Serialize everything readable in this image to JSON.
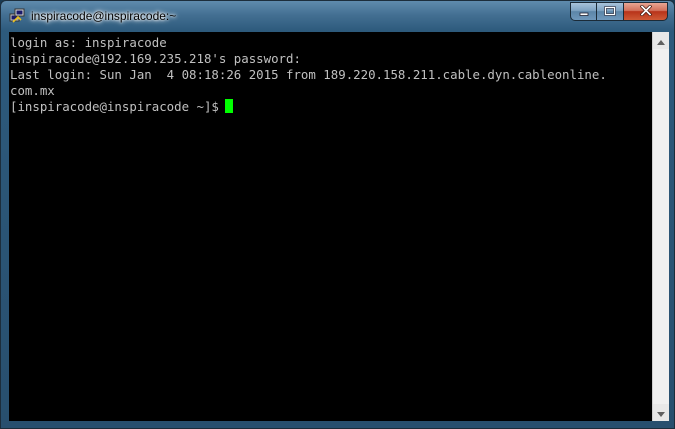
{
  "window": {
    "title": "inspiracode@inspiracode:~",
    "app_icon": "putty-icon",
    "controls": {
      "minimize": "minimize-icon",
      "maximize": "maximize-icon",
      "close": "close-icon"
    }
  },
  "terminal": {
    "lines": [
      "login as: inspiracode",
      "inspiracode@192.169.235.218's password:",
      "Last login: Sun Jan  4 08:18:26 2015 from 189.220.158.211.cable.dyn.cableonline.",
      "com.mx",
      "[inspiracode@inspiracode ~]$"
    ],
    "cursor_color": "#00ff00",
    "text_color": "#c0c0c0",
    "background": "#000000"
  },
  "scrollbar": {
    "up": "scroll-up-arrow-icon",
    "down": "scroll-down-arrow-icon"
  }
}
